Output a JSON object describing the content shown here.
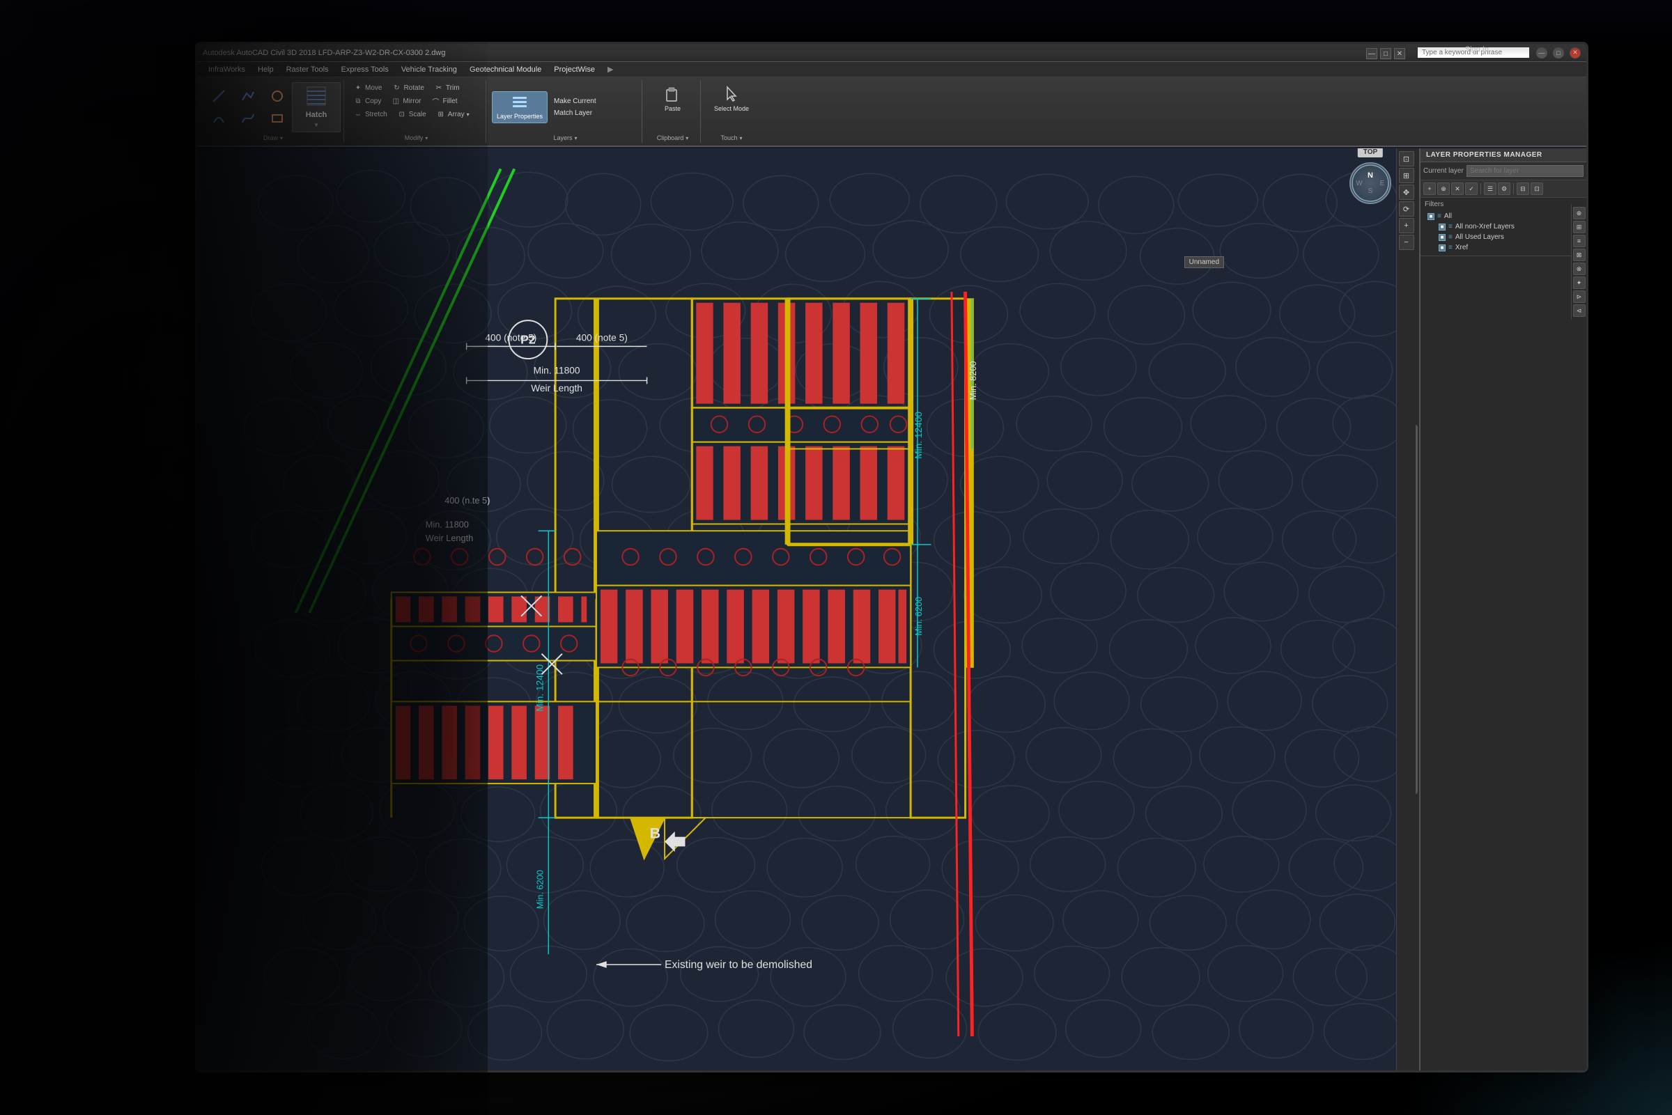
{
  "app": {
    "title": "Autodesk AutoCAD Civil 3D 2018  LFD-ARP-Z3-W2-DR-CX-0300 2.dwg",
    "search_placeholder": "Type a keyword or phrase",
    "sign_in": "Sign In"
  },
  "menu": {
    "items": [
      "InfraWorks",
      "Help",
      "Raster Tools",
      "Express Tools",
      "Vehicle Tracking",
      "Geotechnical Module",
      "ProjectWise"
    ]
  },
  "ribbon": {
    "hatch_label": "Hatch",
    "draw_label": "Draw",
    "modify_label": "Modify",
    "layers_label": "Layers",
    "clipboard_label": "Clipboard",
    "touch_label": "Touch",
    "tools": {
      "move": "Move",
      "rotate": "Rotate",
      "trim": "Trim",
      "copy": "Copy",
      "mirror": "Mirror",
      "fillet": "Fillet",
      "stretch": "Stretch",
      "scale": "Scale",
      "array": "Array",
      "layer_properties": "Layer Properties",
      "make_current": "Make Current",
      "match_layer": "Match Layer",
      "paste": "Paste",
      "select_mode": "Select Mode"
    }
  },
  "viewport": {
    "compass_label": "TOP",
    "minimize": "—",
    "maximize": "□",
    "close": "✕",
    "unnamed_label": "Unnamed"
  },
  "layer_panel": {
    "title": "LAYER PROPERTIES MANAGER",
    "current_layer_label": "Current layer",
    "search_placeholder": "Search for layer",
    "filters_label": "Filters",
    "all_label": "All",
    "all_non_xref": "All non-Xref Layers",
    "all_used": "All Used Layers",
    "xref": "Xref"
  },
  "cad_drawing": {
    "annotations": [
      "400 (note 5)",
      "400 (note 5)",
      "Min. 11800",
      "Weir Length",
      "400 (n.te 5)",
      "Min. 11800",
      "Weir Length",
      "Min. 12400",
      "Min. 12400",
      "Min. 8200",
      "Min. 6200",
      "Min. 6200",
      "P2",
      "B",
      "Existing weir to be demolished"
    ]
  },
  "colors": {
    "cad_bg": "#1e2635",
    "yellow_outline": "#d4b800",
    "red_hatch": "#cc3333",
    "green_line": "#22cc22",
    "white_text": "#e0e0e0",
    "cyan_dim": "#00cccc",
    "red_diagonal": "#ff2222"
  }
}
